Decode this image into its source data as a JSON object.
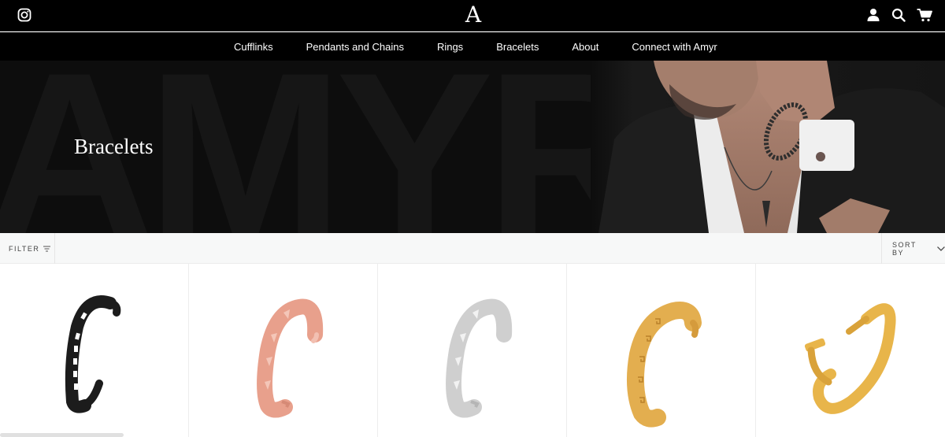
{
  "header": {
    "logo_letter": "A",
    "icons": [
      "instagram-icon",
      "account-icon",
      "search-icon",
      "cart-icon"
    ]
  },
  "nav": {
    "items": [
      "Cufflinks",
      "Pendants and Chains",
      "Rings",
      "Bracelets",
      "About",
      "Connect with Amyr"
    ]
  },
  "hero": {
    "title": "Bracelets",
    "background_letters": "AMYR"
  },
  "toolbar": {
    "filter_label": "FILTER",
    "sort_label": "SORT BY"
  },
  "products": [
    {
      "name": "black-cuff-bracelet",
      "color": "#1c1c1c"
    },
    {
      "name": "rose-gold-studded-cuff",
      "color": "#e8a08c"
    },
    {
      "name": "silver-studded-cuff",
      "color": "#cfcfcf"
    },
    {
      "name": "gold-greek-key-cuff",
      "color": "#e3ae4f"
    },
    {
      "name": "gold-nail-bracelet",
      "color": "#e8b54a"
    }
  ],
  "colors": {
    "header_bg": "#000000",
    "hero_bg": "#0d0d0d",
    "toolbar_bg": "#f7f8f8"
  }
}
